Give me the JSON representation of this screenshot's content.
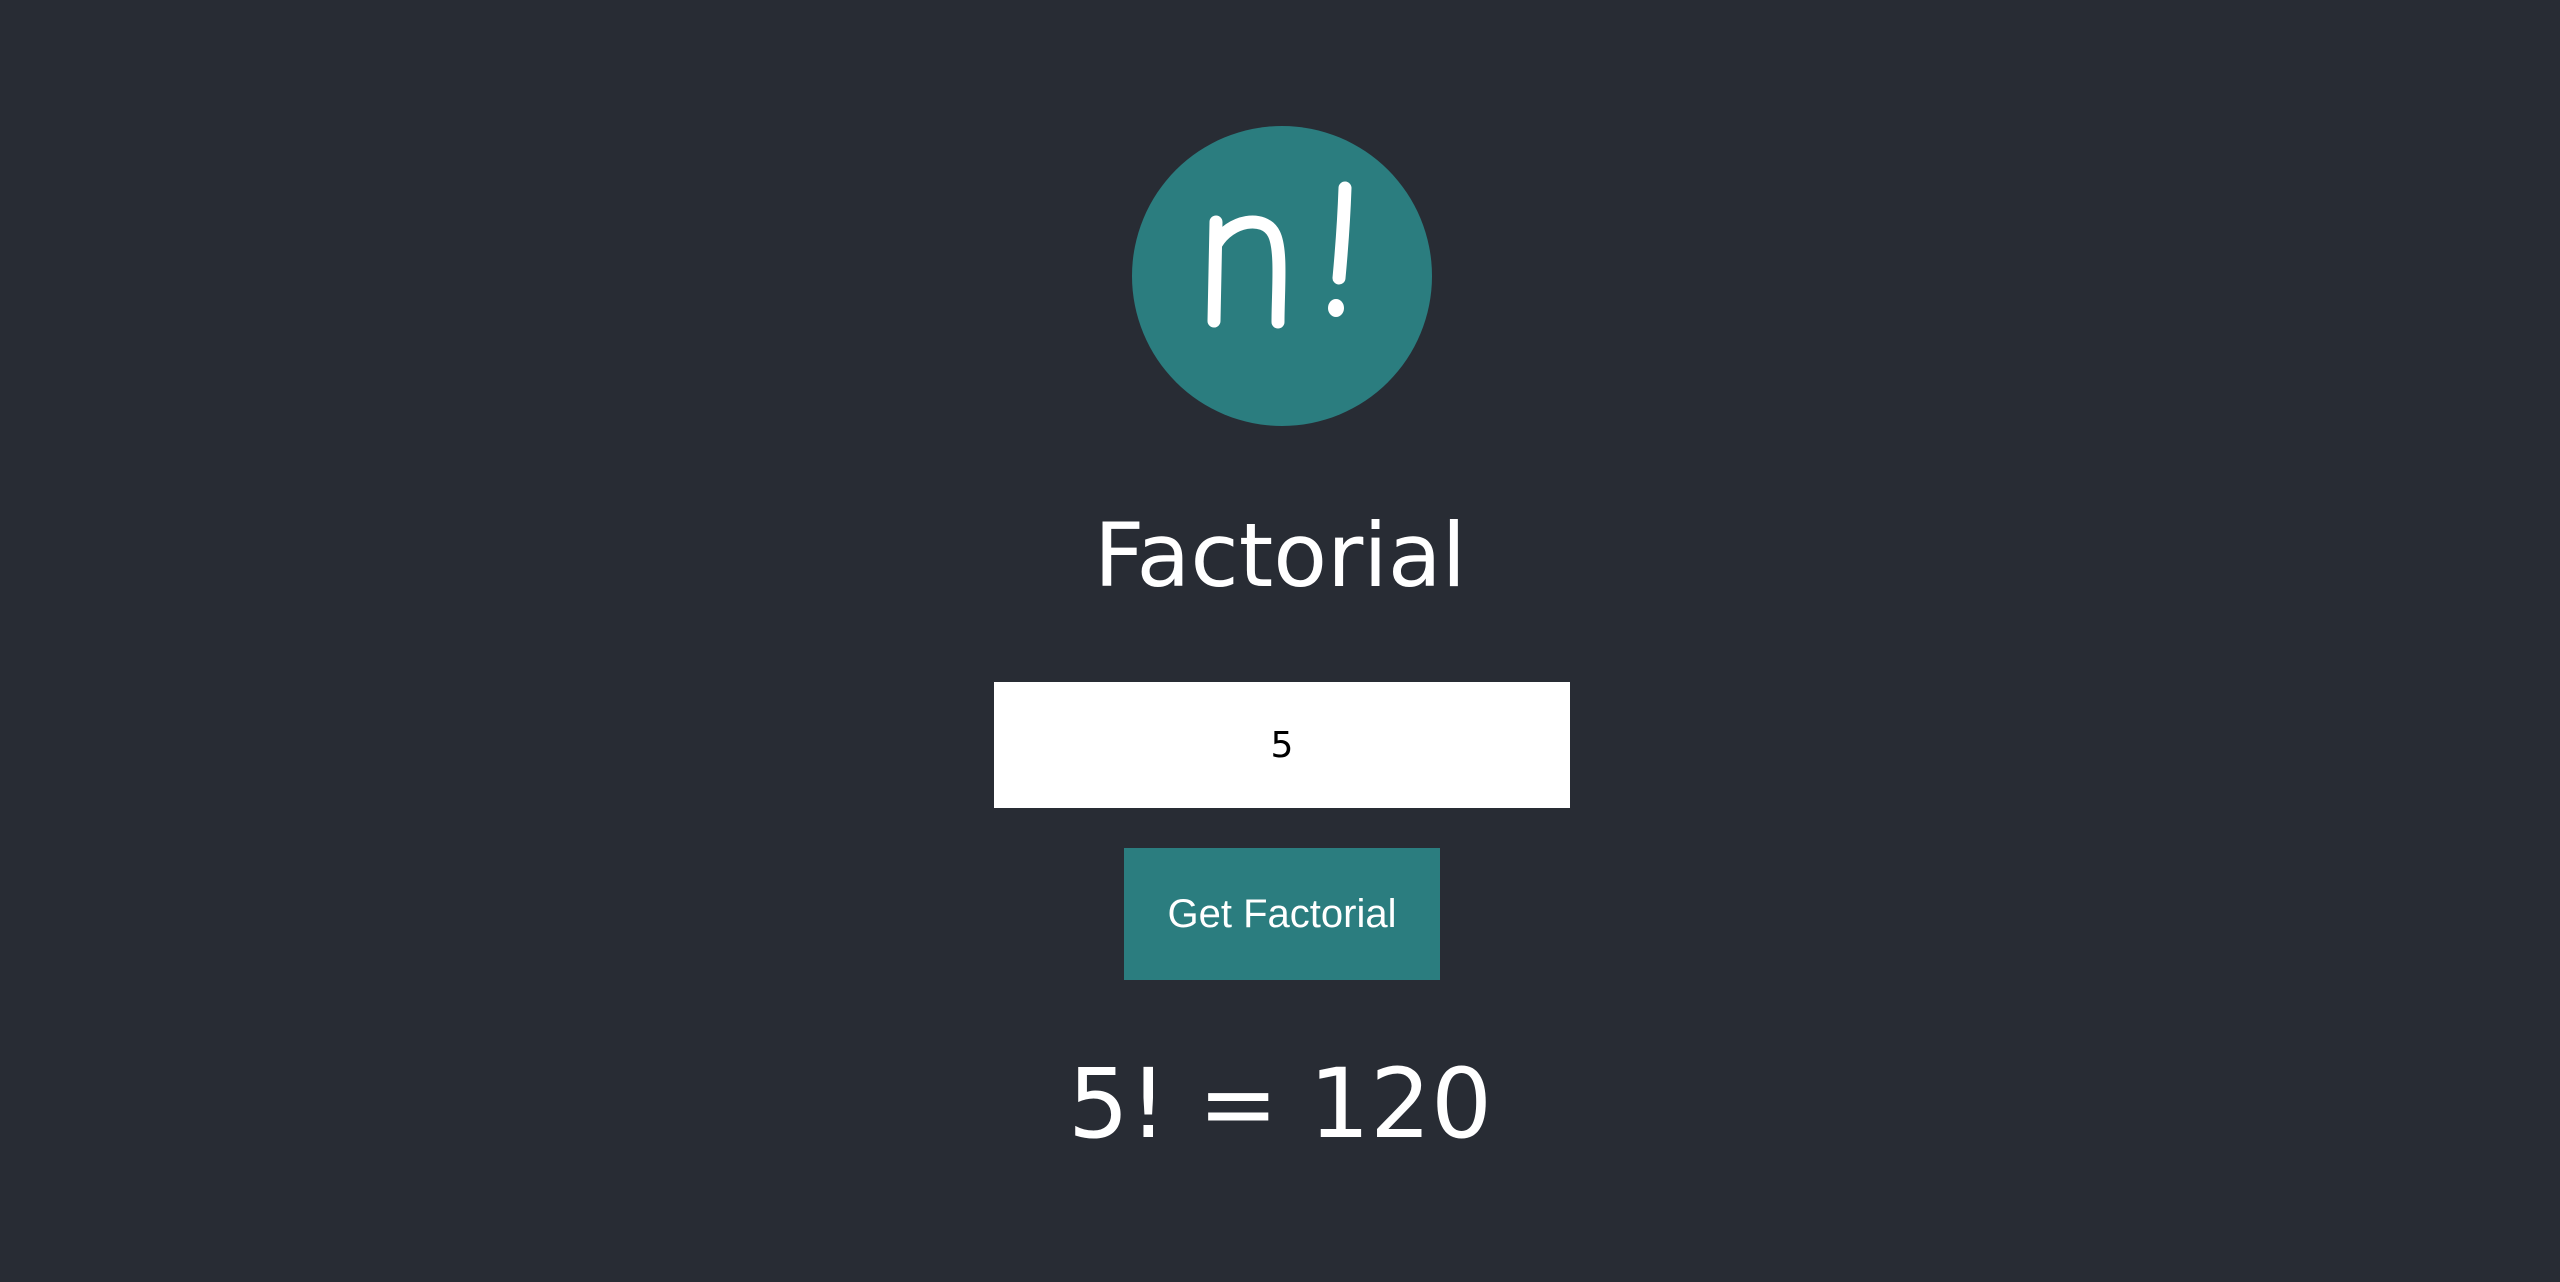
{
  "logo": {
    "text": "n!",
    "icon": "factorial-logo-icon",
    "color": "#2b7d7f"
  },
  "title": "Factorial",
  "input": {
    "value": "5"
  },
  "button": {
    "label": "Get Factorial",
    "color": "#2b7d7f"
  },
  "result": "5! = 120",
  "colors": {
    "background": "#282c34",
    "accent": "#2b7d7f",
    "text": "#ffffff"
  }
}
